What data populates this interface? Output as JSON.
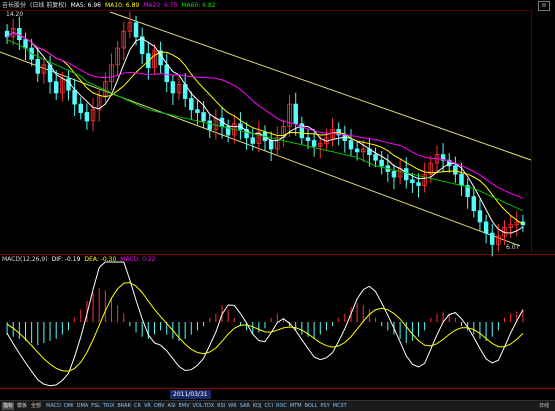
{
  "title": {
    "name": "吉长股份",
    "period": "(日线 前复权)",
    "ma5": "MA5: 6.96",
    "ma10": "MA10: 6.89",
    "ma20": "MA20: 6.75",
    "ma60": "MA60: 6.82"
  },
  "price": {
    "high_label": "14.20",
    "low_label": "6.07"
  },
  "macd": {
    "name": "MACD(12,26,9)",
    "dif": "DIF: -0.19",
    "dea": "DEA: -0.30",
    "macd": "MACD: 0.22"
  },
  "date_cursor": "2011/03/31",
  "tabs": [
    "指标",
    "模板",
    "全部"
  ],
  "functions": [
    "MACD",
    "DMI",
    "DMA",
    "FSL",
    "TRIX",
    "BRAR",
    "CR",
    "VR",
    "OBV",
    "ASI",
    "EMV",
    "VOL-TDX",
    "RSI",
    "WR",
    "SAR",
    "KDJ",
    "CCI",
    "ROC",
    "MTM",
    "BOLL",
    "PSY",
    "MCST"
  ],
  "period_button": "日线",
  "corner_button": "W",
  "colors": {
    "up": "#ff3232",
    "down": "#54fcfc",
    "ma5": "#ffffff",
    "ma10": "#ffff00",
    "ma20": "#ff00ff",
    "ma60": "#00c000",
    "channel": "#e8e07a"
  },
  "chart_data": {
    "type": "candlestick",
    "price_range": [
      6.07,
      14.2
    ],
    "closes": [
      13.6,
      13.9,
      13.5,
      13.2,
      12.8,
      12.3,
      12.6,
      12.0,
      11.6,
      12.1,
      11.7,
      11.2,
      10.9,
      10.6,
      11.0,
      11.5,
      12.0,
      12.6,
      13.2,
      13.8,
      14.1,
      13.6,
      13.0,
      12.5,
      13.1,
      12.6,
      12.0,
      11.6,
      11.9,
      11.4,
      11.0,
      10.9,
      10.6,
      10.3,
      10.7,
      10.4,
      10.1,
      10.5,
      10.3,
      10.0,
      9.8,
      10.2,
      9.9,
      9.6,
      10.0,
      10.4,
      11.2,
      10.5,
      10.0,
      9.9,
      9.7,
      9.8,
      10.0,
      10.3,
      10.1,
      9.9,
      9.6,
      9.5,
      9.6,
      9.4,
      9.2,
      9.0,
      8.8,
      8.6,
      8.9,
      8.5,
      8.4,
      8.3,
      8.7,
      9.1,
      9.4,
      9.2,
      9.0,
      8.7,
      8.3,
      7.9,
      7.4,
      7.0,
      6.6,
      6.2,
      6.5,
      6.8,
      6.9,
      7.0,
      6.9
    ],
    "ma60": [
      13.5,
      13.4,
      13.3,
      13.2,
      13.0,
      12.9,
      12.8,
      12.7,
      12.6,
      12.5,
      12.4,
      12.3,
      12.2,
      12.0,
      11.9,
      11.8,
      11.7,
      11.6,
      11.5,
      11.4,
      11.3,
      11.2,
      11.1,
      11.0,
      10.95,
      10.9,
      10.85,
      10.8,
      10.75,
      10.7,
      10.65,
      10.6,
      10.55,
      10.5,
      10.45,
      10.4,
      10.35,
      10.3,
      10.25,
      10.2,
      10.15,
      10.1,
      10.05,
      10.0,
      9.95,
      9.9,
      9.85,
      9.8,
      9.75,
      9.7,
      9.65,
      9.6,
      9.55,
      9.5,
      9.45,
      9.4,
      9.35,
      9.3,
      9.2,
      9.1,
      9.0,
      8.95,
      8.9,
      8.85,
      8.8,
      8.75,
      8.7,
      8.65,
      8.6,
      8.55,
      8.5,
      8.45,
      8.4,
      8.35,
      8.3,
      8.25,
      8.2,
      8.1,
      8.0,
      7.9,
      7.8,
      7.7,
      7.6,
      7.5,
      7.4
    ],
    "macd_hist": [
      -0.3,
      -0.35,
      -0.4,
      -0.45,
      -0.5,
      -0.55,
      -0.5,
      -0.45,
      -0.4,
      -0.3,
      -0.2,
      0.1,
      0.3,
      0.5,
      0.7,
      0.8,
      0.75,
      0.6,
      0.4,
      0.2,
      -0.1,
      -0.25,
      -0.35,
      -0.4,
      -0.3,
      -0.2,
      -0.3,
      -0.4,
      -0.45,
      -0.4,
      -0.3,
      -0.2,
      -0.1,
      0.1,
      0.2,
      0.4,
      0.3,
      0.1,
      -0.1,
      -0.2,
      -0.3,
      -0.25,
      -0.15,
      0.1,
      0.2,
      0.1,
      -0.1,
      -0.2,
      -0.3,
      -0.35,
      -0.4,
      -0.3,
      -0.2,
      -0.1,
      0.1,
      0.2,
      0.35,
      0.45,
      0.4,
      0.3,
      0.1,
      -0.1,
      -0.2,
      -0.3,
      -0.4,
      -0.5,
      -0.45,
      -0.35,
      -0.2,
      0.1,
      0.2,
      0.25,
      0.2,
      0.1,
      -0.1,
      -0.2,
      -0.3,
      -0.4,
      -0.45,
      -0.35,
      -0.2,
      0.1,
      0.2,
      0.25,
      0.3
    ]
  }
}
